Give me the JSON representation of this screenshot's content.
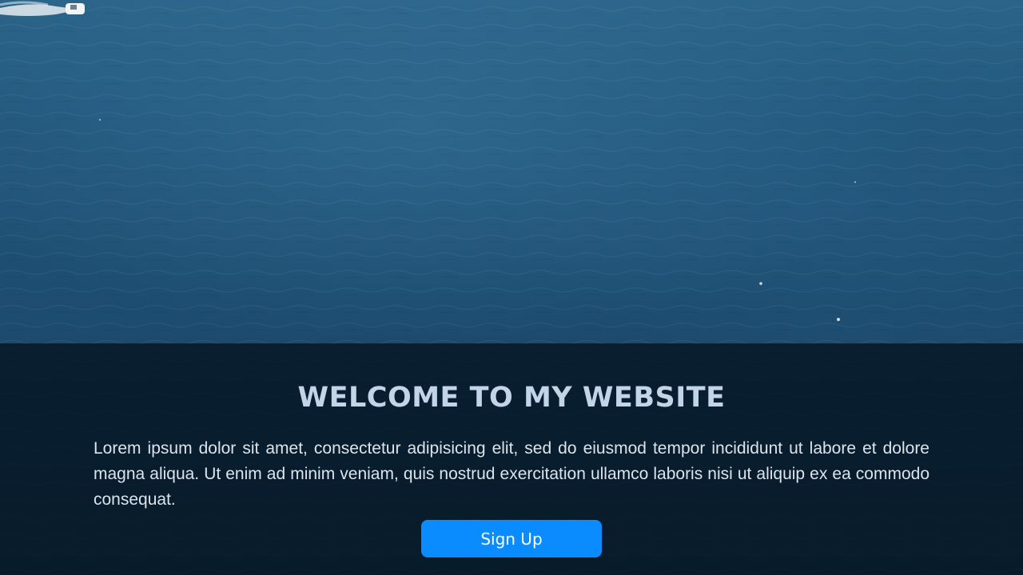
{
  "hero": {
    "title": "WELCOME TO MY WEBSITE",
    "description": "Lorem ipsum dolor sit amet, consectetur adipisicing elit, sed do eiusmod tempor incididunt ut labore et dolore magna aliqua. Ut enim ad minim veniam, quis nostrud exercitation ullamco laboris nisi ut aliquip ex ea commodo consequat.",
    "button_label": "Sign Up"
  },
  "colors": {
    "ocean": "#1e4f73",
    "overlay": "#04121e",
    "title": "#c3d3e8",
    "button": "#0a8cff"
  }
}
